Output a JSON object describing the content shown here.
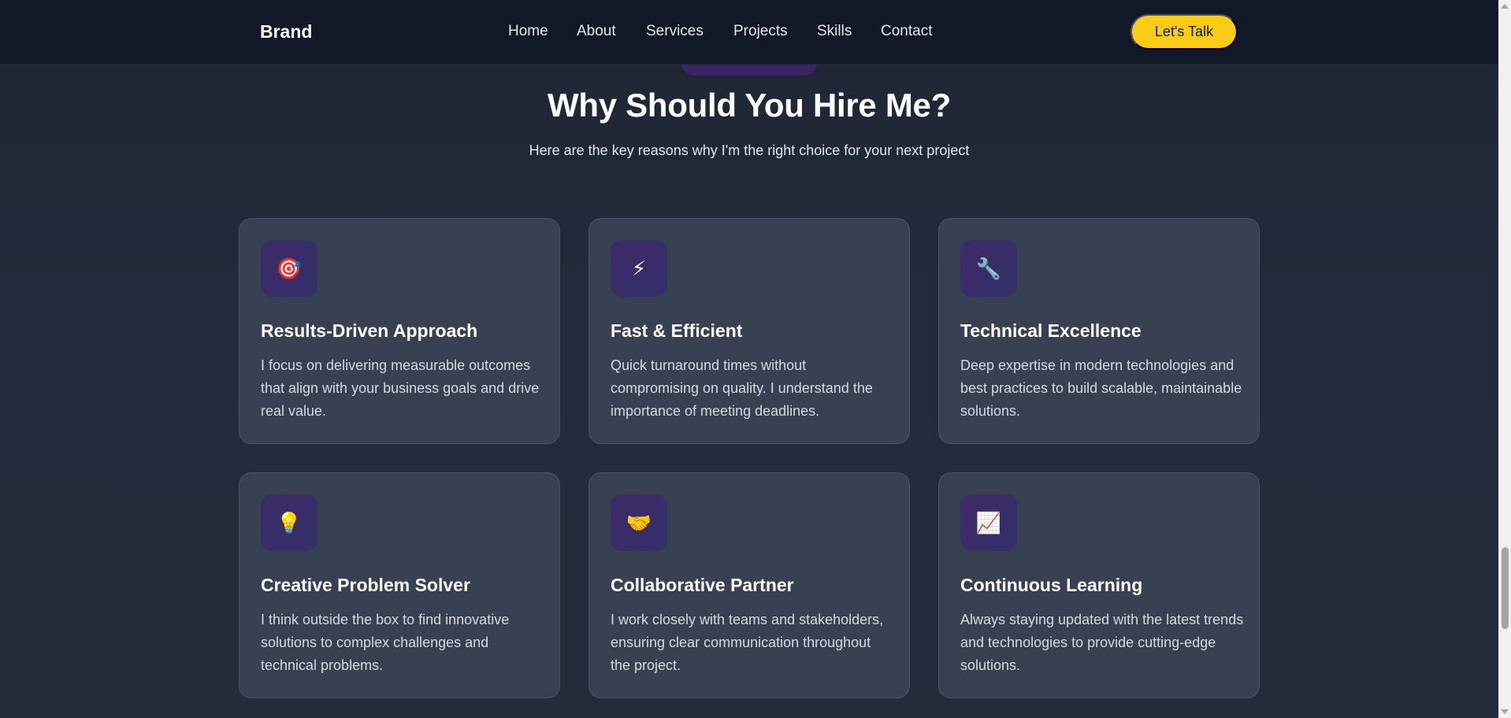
{
  "navbar": {
    "brand": "Brand",
    "links": [
      "Home",
      "About",
      "Services",
      "Projects",
      "Skills",
      "Contact"
    ],
    "cta_label": "Let's Talk"
  },
  "section": {
    "title": "Why Should You Hire Me?",
    "subtitle": "Here are the key reasons why I'm the right choice for your next project"
  },
  "cards": [
    {
      "icon": "target-icon",
      "emoji": "🎯",
      "title": "Results-Driven Approach",
      "description": "I focus on delivering measurable outcomes that align with your business goals and drive real value."
    },
    {
      "icon": "lightning-icon",
      "emoji": "⚡",
      "title": "Fast & Efficient",
      "description": "Quick turnaround times without compromising on quality. I understand the importance of meeting deadlines."
    },
    {
      "icon": "wrench-icon",
      "emoji": "🔧",
      "title": "Technical Excellence",
      "description": "Deep expertise in modern technologies and best practices to build scalable, maintainable solutions."
    },
    {
      "icon": "lightbulb-icon",
      "emoji": "💡",
      "title": "Creative Problem Solver",
      "description": "I think outside the box to find innovative solutions to complex challenges and technical problems."
    },
    {
      "icon": "handshake-icon",
      "emoji": "🤝",
      "title": "Collaborative Partner",
      "description": "I work closely with teams and stakeholders, ensuring clear communication throughout the project."
    },
    {
      "icon": "chart-increasing-icon",
      "emoji": "📈",
      "title": "Continuous Learning",
      "description": "Always staying updated with the latest trends and technologies to provide cutting-edge solutions."
    }
  ],
  "colors": {
    "navbar_bg": "#111827",
    "page_bg": "#222b3a",
    "card_bg": "#374151",
    "icon_bg": "#3d2a66",
    "cta_bg": "#facc15"
  }
}
